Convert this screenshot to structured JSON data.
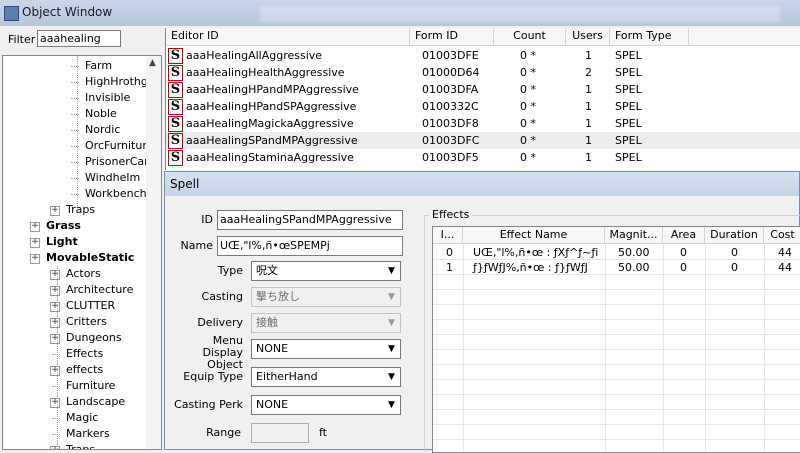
{
  "object_window": {
    "title": "Object Window",
    "filter_label": "Filter",
    "filter_value": "aaahealing"
  },
  "tree": {
    "items": [
      {
        "label": "Farm",
        "bold": false
      },
      {
        "label": "HighHrothg",
        "bold": false
      },
      {
        "label": "Invisible",
        "bold": false
      },
      {
        "label": "Noble",
        "bold": false
      },
      {
        "label": "Nordic",
        "bold": false
      },
      {
        "label": "OrcFurnitur",
        "bold": false
      },
      {
        "label": "PrisonerCar",
        "bold": false
      },
      {
        "label": "Windhelm",
        "bold": false
      },
      {
        "label": "Workbench",
        "bold": false
      },
      {
        "label": "Traps",
        "bold": false
      },
      {
        "label": "Grass",
        "bold": true
      },
      {
        "label": "Light",
        "bold": true
      },
      {
        "label": "MovableStatic",
        "bold": true
      },
      {
        "label": "Actors",
        "bold": false
      },
      {
        "label": "Architecture",
        "bold": false
      },
      {
        "label": "CLUTTER",
        "bold": false
      },
      {
        "label": "Critters",
        "bold": false
      },
      {
        "label": "Dungeons",
        "bold": false
      },
      {
        "label": "Effects",
        "bold": false
      },
      {
        "label": "effects",
        "bold": false
      },
      {
        "label": "Furniture",
        "bold": false
      },
      {
        "label": "Landscape",
        "bold": false
      },
      {
        "label": "Magic",
        "bold": false
      },
      {
        "label": "Markers",
        "bold": false
      },
      {
        "label": "Traps",
        "bold": false
      }
    ]
  },
  "list": {
    "columns": [
      "Editor ID",
      "Form ID",
      "Count",
      "Users",
      "Form Type"
    ],
    "icon_letter": "S",
    "rows": [
      {
        "editor_id": "aaaHealingAllAggressive",
        "form_id": "01003DFE",
        "count": "0 *",
        "users": "1",
        "form_type": "SPEL"
      },
      {
        "editor_id": "aaaHealingHealthAggressive",
        "form_id": "01000D64",
        "count": "0 *",
        "users": "2",
        "form_type": "SPEL"
      },
      {
        "editor_id": "aaaHealingHPandMPAggressive",
        "form_id": "01003DFA",
        "count": "0 *",
        "users": "1",
        "form_type": "SPEL"
      },
      {
        "editor_id": "aaaHealingHPandSPAggressive",
        "form_id": "0100332C",
        "count": "0 *",
        "users": "1",
        "form_type": "SPEL"
      },
      {
        "editor_id": "aaaHealingMagickaAggressive",
        "form_id": "01003DF8",
        "count": "0 *",
        "users": "1",
        "form_type": "SPEL"
      },
      {
        "editor_id": "aaaHealingSPandMPAggressive",
        "form_id": "01003DFC",
        "count": "0 *",
        "users": "1",
        "form_type": "SPEL"
      },
      {
        "editor_id": "aaaHealingStaminaAggressive",
        "form_id": "01003DF5",
        "count": "0 *",
        "users": "1",
        "form_type": "SPEL"
      }
    ]
  },
  "spell": {
    "title": "Spell",
    "id_label": "ID",
    "id_value": "aaaHealingSPandMPAggressive",
    "name_label": "Name",
    "name_value": "UŒ‚\"l%‚ñ•œSPEMPj",
    "type_label": "Type",
    "type_value": "呪文",
    "casting_label": "Casting",
    "casting_value": "撃ち放し",
    "delivery_label": "Delivery",
    "delivery_value": "接触",
    "menu_display_label_1": "Menu Display",
    "menu_display_label_2": "Object",
    "menu_display_value": "NONE",
    "equip_type_label": "Equip Type",
    "equip_type_value": "EitherHand",
    "casting_perk_label": "Casting Perk",
    "casting_perk_value": "NONE",
    "range_label": "Range",
    "range_unit": "ft"
  },
  "effects": {
    "group_label": "Effects",
    "columns": [
      "I...",
      "Effect Name",
      "Magnit...",
      "Area",
      "Duration",
      "Cost"
    ],
    "rows": [
      {
        "index": "0",
        "name": "UŒ‚\"l%‚ñ•œ : ƒXƒ^ƒ~ƒi",
        "magnitude": "50.00",
        "area": "0",
        "duration": "0",
        "cost": "44"
      },
      {
        "index": "1",
        "name": "ƒ}ƒWƒJ%‚ñ•œ : ƒ}ƒWƒJ",
        "magnitude": "50.00",
        "area": "0",
        "duration": "0",
        "cost": "44"
      }
    ]
  }
}
